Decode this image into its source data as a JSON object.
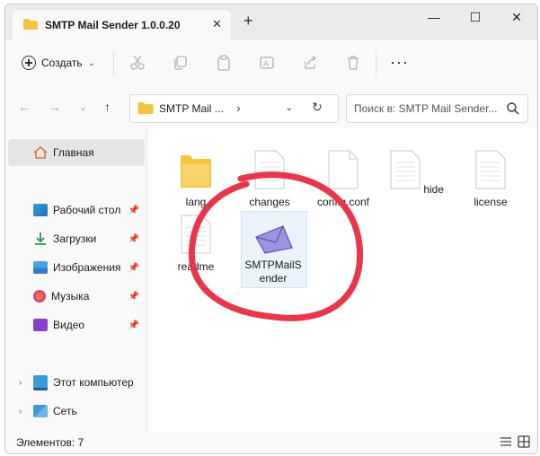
{
  "window": {
    "tab_title": "SMTP Mail Sender 1.0.0.20",
    "tab_close": "✕",
    "tab_add": "+",
    "minimize": "—",
    "maximize": "☐",
    "close": "✕"
  },
  "toolbar": {
    "create_label": "Создать",
    "create_chevron": "⌄",
    "more": "···"
  },
  "address": {
    "back": "←",
    "forward": "→",
    "dropdown": "⌄",
    "up": "↑",
    "path": "SMTP Mail ...",
    "path_chevron": "›",
    "addr_chevron": "⌄",
    "refresh": "↻",
    "search_placeholder": "Поиск в: SMTP Mail Sender..."
  },
  "sidebar": {
    "items": [
      {
        "label": "Главная"
      },
      {
        "label": "Рабочий стол"
      },
      {
        "label": "Загрузки"
      },
      {
        "label": "Изображения"
      },
      {
        "label": "Музыка"
      },
      {
        "label": "Видео"
      },
      {
        "label": "Этот компьютер"
      },
      {
        "label": "Сеть"
      }
    ],
    "expand": "›",
    "pin": "📌"
  },
  "files": [
    {
      "name": "lang",
      "type": "folder"
    },
    {
      "name": "changes",
      "type": "file"
    },
    {
      "name": "config.conf",
      "type": "file"
    },
    {
      "name": "hide",
      "type": "file"
    },
    {
      "name": "license",
      "type": "file"
    },
    {
      "name": "readme",
      "type": "file"
    },
    {
      "name": "SMTPMailS ender",
      "type": "app"
    }
  ],
  "status": {
    "count": "Элементов: 7"
  },
  "colors": {
    "annotation": "#e8364a",
    "folder": "#f5c542",
    "envelope": "#7b72c9"
  }
}
